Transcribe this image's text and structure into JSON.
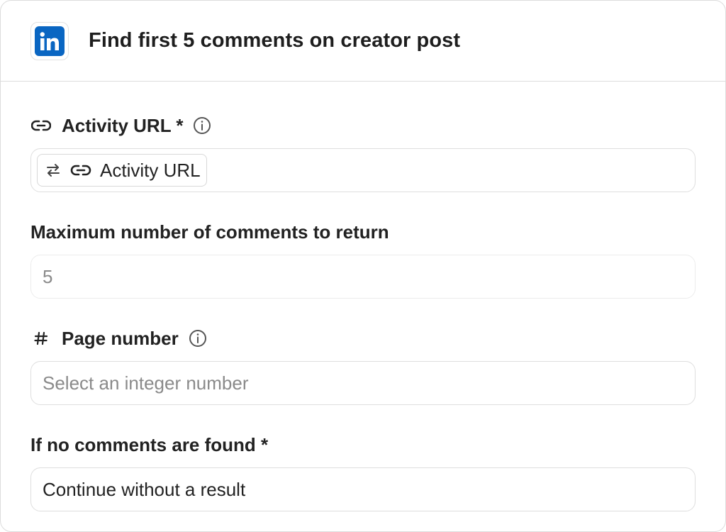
{
  "header": {
    "title": "Find first 5 comments on creator post",
    "logo_icon": "linkedin-icon",
    "logo_color": "#0a66c2"
  },
  "fields": {
    "activity_url": {
      "label": "Activity URL *",
      "label_icon": "link-icon",
      "chip_label": "Activity URL",
      "chip_icons": [
        "swap-icon",
        "link-icon"
      ]
    },
    "max_comments": {
      "label": "Maximum number of comments to return",
      "value": "5"
    },
    "page_number": {
      "label": "Page number",
      "label_icon": "hash-icon",
      "placeholder": "Select an integer number"
    },
    "no_comments": {
      "label": "If no comments are found *",
      "value": "Continue without a result"
    }
  }
}
